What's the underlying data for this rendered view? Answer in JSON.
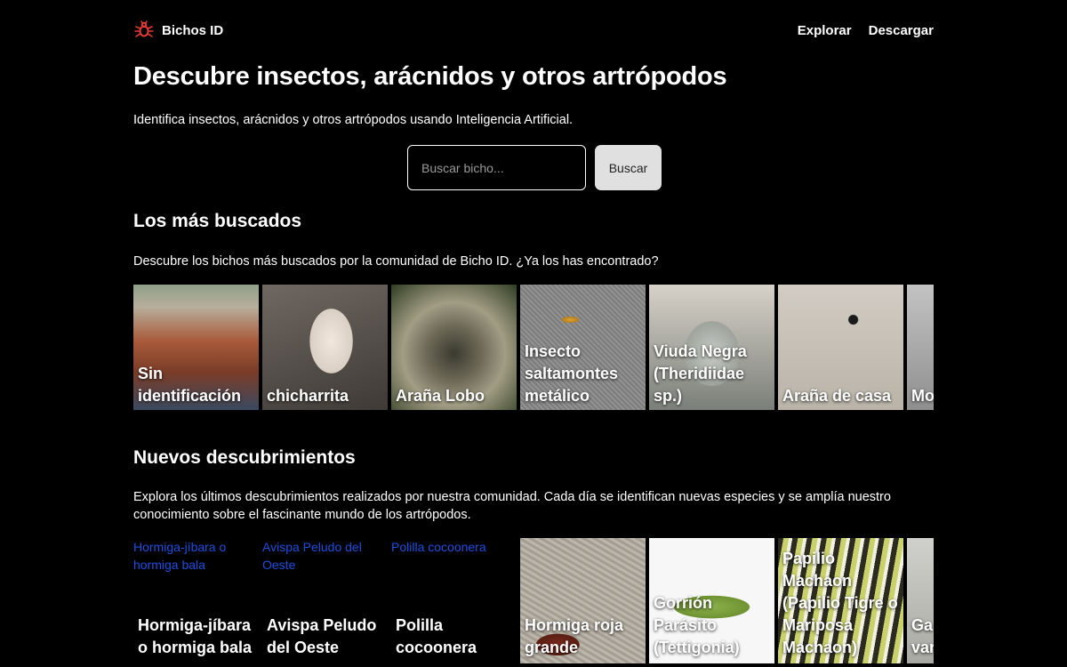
{
  "header": {
    "brand": "Bichos ID",
    "nav": [
      "Explorar",
      "Descargar"
    ]
  },
  "hero": {
    "title": "Descubre insectos, arácnidos y otros artrópodos",
    "subtitle": "Identifica insectos, arácnidos y otros artrópodos usando Inteligencia Artificial."
  },
  "search": {
    "placeholder": "Buscar bicho...",
    "button": "Buscar"
  },
  "popular": {
    "title": "Los más buscados",
    "description": "Descubre los bichos más buscados por la comunidad de Bicho ID. ¿Ya los has encontrado?",
    "items": [
      {
        "label": "Sin identificación"
      },
      {
        "label": "chicharrita"
      },
      {
        "label": "Araña Lobo"
      },
      {
        "label": "Insecto saltamontes metálico"
      },
      {
        "label": "Viuda Negra (Theridiidae sp.)"
      },
      {
        "label": "Araña de casa"
      },
      {
        "label": "Mo (Ca sp."
      }
    ]
  },
  "recent": {
    "title": "Nuevos descubrimientos",
    "description": "Explora los últimos descubrimientos realizados por nuestra comunidad. Cada día se identifican nuevas especies y se amplía nuestro conocimiento sobre el fascinante mundo de los artrópodos.",
    "items": [
      {
        "label": "Hormiga-jíbara o hormiga bala",
        "alt": "Hormiga-jíbara o hormiga bala"
      },
      {
        "label": "Avispa Peludo del Oeste",
        "alt": "Avispa Peludo del Oeste"
      },
      {
        "label": "Polilla cocoonera",
        "alt": "Polilla cocoonera"
      },
      {
        "label": "Hormiga roja grande"
      },
      {
        "label": "Gorrión Parásito (Tettigonia)"
      },
      {
        "label": "Papilio Machaon (Papilio Tigre o Mariposa Machaon)"
      },
      {
        "label": "Ga pe am (Da var"
      }
    ]
  }
}
